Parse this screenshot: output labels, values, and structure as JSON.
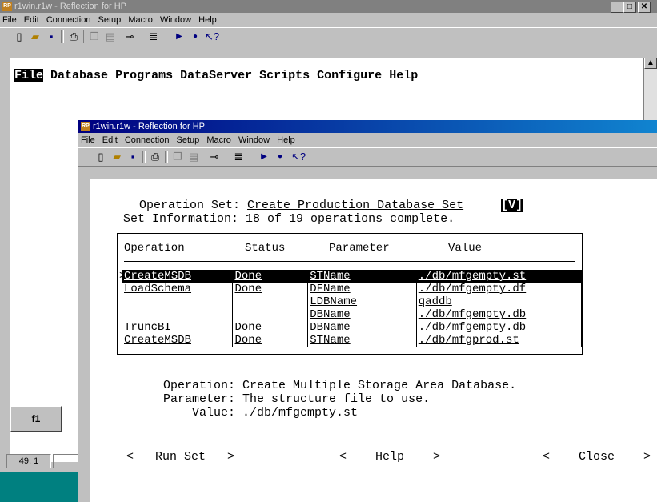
{
  "back_window": {
    "title": "r1win.r1w - Reflection for HP",
    "menu": [
      "File",
      "Edit",
      "Connection",
      "Setup",
      "Macro",
      "Window",
      "Help"
    ],
    "terminal_menu": {
      "selected": "File",
      "items": [
        "Database",
        "Programs",
        "DataServer",
        "Scripts",
        "Configure",
        "Help"
      ]
    },
    "fkey": "f1",
    "status_position": "49, 1"
  },
  "front_window": {
    "title": "r1win.r1w - Reflection for HP",
    "menu": [
      "File",
      "Edit",
      "Connection",
      "Setup",
      "Macro",
      "Window",
      "Help"
    ],
    "operation_set_label": "Operation Set:",
    "operation_set_value": "Create Production Database Set",
    "operation_set_flag": "[V]",
    "set_info_label": "Set Information:",
    "set_info_value": "18 of 19 operations complete.",
    "table": {
      "headers": [
        "Operation",
        "Status",
        "Parameter",
        "Value"
      ],
      "rows": [
        {
          "operation": "CreateMSDB",
          "status": "Done",
          "parameter": "STName",
          "value": "./db/mfgempty.st",
          "selected": true
        },
        {
          "operation": "LoadSchema",
          "status": "Done",
          "parameter": "DFName",
          "value": "./db/mfgempty.df",
          "selected": false
        },
        {
          "operation": "",
          "status": "",
          "parameter": "LDBName",
          "value": "qaddb",
          "selected": false
        },
        {
          "operation": "",
          "status": "",
          "parameter": "DBName",
          "value": "./db/mfgempty.db",
          "selected": false
        },
        {
          "operation": "TruncBI",
          "status": "Done",
          "parameter": "DBName",
          "value": "./db/mfgempty.db",
          "selected": false
        },
        {
          "operation": "CreateMSDB",
          "status": "Done",
          "parameter": "STName",
          "value": "./db/mfgprod.st",
          "selected": false
        }
      ]
    },
    "detail": {
      "operation_label": "Operation:",
      "operation_value": "Create Multiple Storage Area Database.",
      "parameter_label": "Parameter:",
      "parameter_value": "The structure file to use.",
      "value_label": "Value:",
      "value_value": "./db/mfgempty.st"
    },
    "buttons": {
      "run_set": "Run Set",
      "help": "Help",
      "close": "Close"
    }
  }
}
